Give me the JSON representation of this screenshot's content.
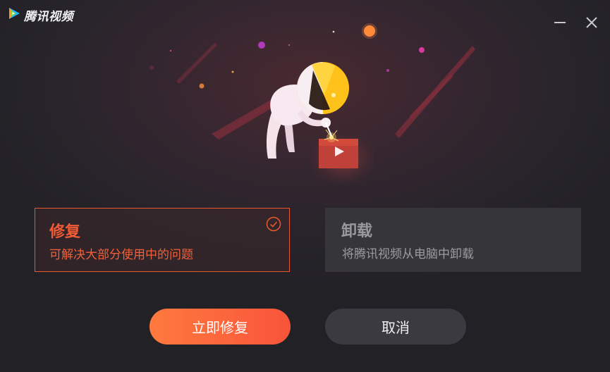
{
  "window": {
    "app_title": "腾讯视频",
    "logo_icon": "tencent-video-logo-icon",
    "minimize_icon": "minimize-icon",
    "close_icon": "close-icon"
  },
  "illustration": {
    "name": "astronaut-welding-video-icon-illustration"
  },
  "options": {
    "repair": {
      "title": "修复",
      "description": "可解决大部分使用中的问题",
      "selected": true,
      "check_icon": "check-circle-icon"
    },
    "uninstall": {
      "title": "卸载",
      "description": "将腾讯视频从电脑中卸载",
      "selected": false
    }
  },
  "actions": {
    "confirm_label": "立即修复",
    "cancel_label": "取消"
  },
  "colors": {
    "accent": "#f25b36",
    "button_gradient_start": "#ff7a3e",
    "button_gradient_end": "#f8543b",
    "background": "#26242a",
    "card_inactive": "#363638",
    "button_secondary": "#3b3a40"
  }
}
